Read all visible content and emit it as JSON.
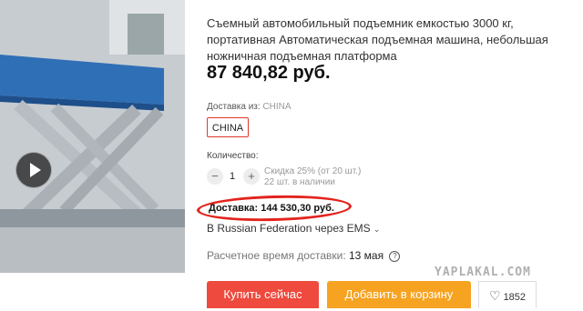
{
  "product": {
    "title": "Съемный автомобильный подъемник емкостью 3000 кг, портативная Автоматическая подъемная машина, небольшая ножничная подъемная платформа",
    "price": "87 840,82 руб."
  },
  "ship_from": {
    "label": "Доставка из:",
    "value": "CHINA",
    "option": "CHINA"
  },
  "quantity": {
    "label": "Количество:",
    "minus": "−",
    "value": "1",
    "plus": "+",
    "discount": "Скидка 25% (от 20 шт.)",
    "stock": "22 шт. в наличии"
  },
  "delivery": {
    "cost": "Доставка: 144 530,30 руб.",
    "via": "В Russian Federation через EMS",
    "est_label": "Расчетное время доставки:",
    "est_date": "13 мая",
    "help": "?"
  },
  "actions": {
    "buy": "Купить сейчас",
    "cart": "Добавить в корзину",
    "wishlist_count": "1852"
  },
  "watermark": "YAPLAKAL.COM",
  "colors": {
    "accent_red": "#e3231d",
    "buy": "#ee4a3e",
    "cart": "#f6a321"
  },
  "icons": [
    "play-icon",
    "chevron-down-icon",
    "help-icon",
    "heart-icon"
  ]
}
